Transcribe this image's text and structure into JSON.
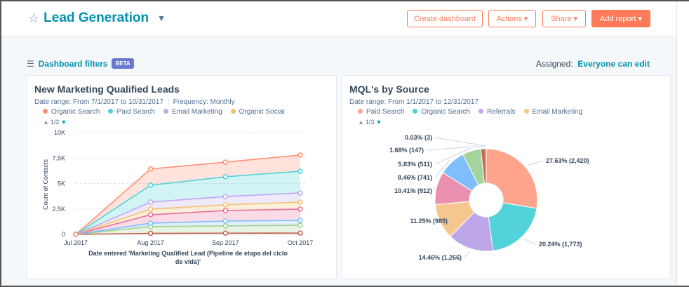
{
  "header": {
    "title": "Lead Generation",
    "buttons": {
      "create": "Create dashboard",
      "actions": "Actions",
      "share": "Share",
      "add_report": "Add report"
    }
  },
  "filters": {
    "label": "Dashboard filters",
    "badge": "BETA",
    "assigned_label": "Assigned:",
    "assigned_value": "Everyone can edit"
  },
  "colors": {
    "accent": "#0091ae",
    "primary_button": "#ff7a59"
  },
  "cards": [
    {
      "title": "New Marketing Qualified Leads",
      "date_range": "Date range: From 7/1/2017 to 10/31/2017",
      "frequency": "Frequency: Monthly",
      "page": "1/2"
    },
    {
      "title": "MQL's by Source",
      "date_range": "Date range: From 1/1/2017 to 12/31/2017",
      "page": "1/3"
    }
  ],
  "chart_data": [
    {
      "type": "area",
      "stacked": true,
      "categories": [
        "Jul 2017",
        "Aug 2017",
        "Sep 2017",
        "Oct 2017"
      ],
      "ylabel": "Count of Contacts",
      "xlabel": "Date entered 'Marketing Qualified Lead (Pipeline de etapa del ciclo de vida)'",
      "ylim": [
        0,
        10000
      ],
      "yticks": [
        "0",
        "2.5K",
        "5K",
        "7.5K",
        "10K"
      ],
      "grid": true,
      "legend": "top",
      "series": [
        {
          "name": "Organic Search",
          "color": "#ff8f73",
          "values": [
            0,
            1600,
            1440,
            1600
          ]
        },
        {
          "name": "Paid Search",
          "color": "#51d3d9",
          "values": [
            0,
            1660,
            1940,
            2130
          ]
        },
        {
          "name": "Email Marketing",
          "color": "#bda7f0",
          "values": [
            0,
            690,
            820,
            900
          ]
        },
        {
          "name": "Organic Social",
          "color": "#f5c26b",
          "values": [
            0,
            550,
            560,
            690
          ]
        },
        {
          "color": "#ea6f9b",
          "values": [
            0,
            830,
            1030,
            1100
          ]
        },
        {
          "color": "#7fbefc",
          "values": [
            0,
            340,
            480,
            480
          ]
        },
        {
          "color": "#a2d28f",
          "values": [
            0,
            660,
            710,
            770
          ]
        },
        {
          "color": "#c05e4e",
          "values": [
            0,
            100,
            120,
            130
          ]
        }
      ]
    },
    {
      "type": "pie",
      "donut": true,
      "legend": "top",
      "slices": [
        {
          "name": "Paid Search",
          "color": "#ffa48c",
          "percent": 27.63,
          "value": 2420,
          "label": "27.63% (2,420)"
        },
        {
          "name": "Organic Search",
          "color": "#51d3d9",
          "percent": 20.24,
          "value": 1773,
          "label": "20.24% (1,773)"
        },
        {
          "name": "Referrals",
          "color": "#bda7ea",
          "percent": 14.46,
          "value": 1266,
          "label": "14.46% (1,266)"
        },
        {
          "name": "Email Marketing",
          "color": "#f5c78e",
          "percent": 11.25,
          "value": 985,
          "label": "11.25% (985)"
        },
        {
          "color": "#ea90b1",
          "percent": 10.41,
          "value": 912,
          "label": "10.41% (912)"
        },
        {
          "color": "#80bdfb",
          "percent": 8.46,
          "value": 741,
          "label": "8.46% (741)"
        },
        {
          "color": "#a2d49b",
          "percent": 5.83,
          "value": 511,
          "label": "5.83% (511)"
        },
        {
          "color": "#c76b5b",
          "percent": 1.68,
          "value": 147,
          "label": "1.68% (147)"
        },
        {
          "color": "#888888",
          "percent": 0.03,
          "value": 3,
          "label": "0.03% (3)"
        }
      ]
    }
  ]
}
